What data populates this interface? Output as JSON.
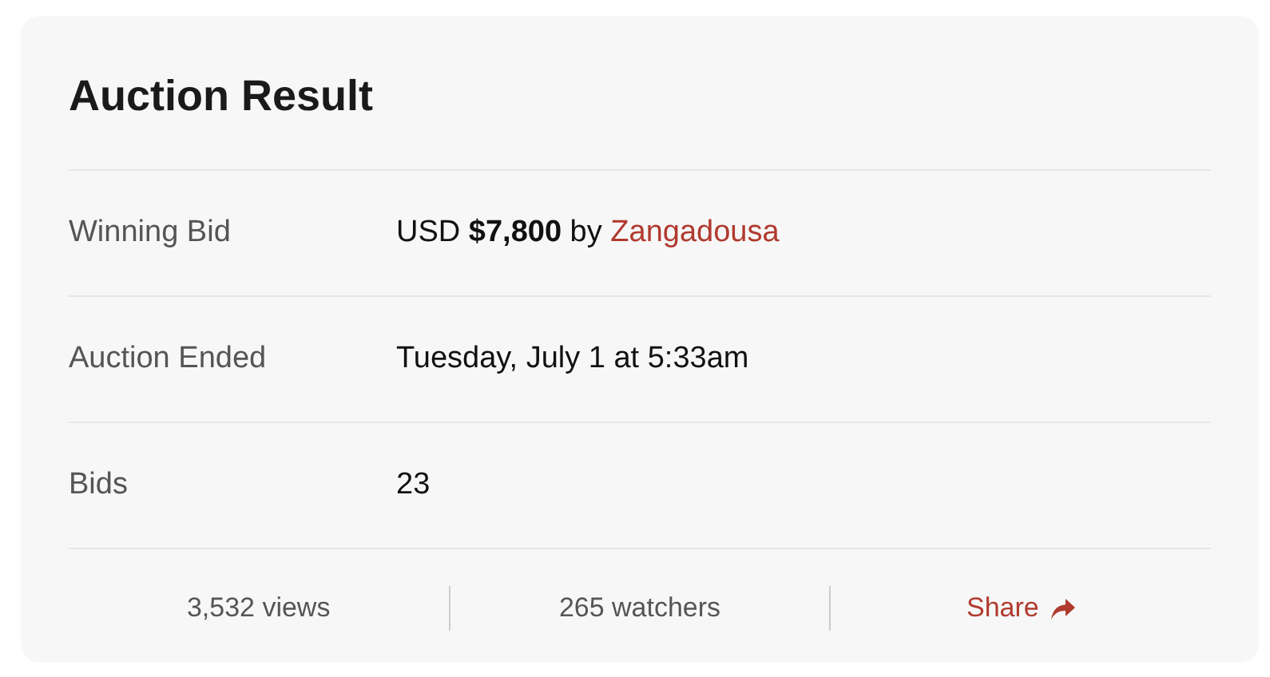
{
  "title": "Auction Result",
  "rows": [
    {
      "label": "Winning Bid",
      "value": "USD **$7,800** by ",
      "link": "Zangadousa"
    },
    {
      "label": "Auction Ended",
      "value": "Tuesday, July 1 at 5:33am"
    },
    {
      "label": "Bids",
      "value": "23"
    }
  ],
  "footer": {
    "stats": [
      "3,532 views",
      "265 watchers"
    ],
    "share": "Share"
  }
}
